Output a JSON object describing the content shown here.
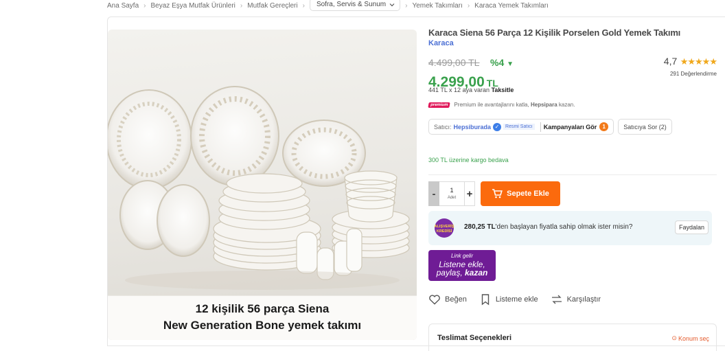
{
  "breadcrumb": {
    "items": [
      "Ana Sayfa",
      "Beyaz Eşya Mutfak Ürünleri",
      "Mutfak Gereçleri",
      "Sofra, Servis & Sunum",
      "Yemek Takımları",
      "Karaca Yemek Takımları"
    ]
  },
  "product": {
    "title": "Karaca Siena 56 Parça 12 Kişilik Porselen Gold Yemek Takımı",
    "brand": "Karaca",
    "old_price": "4.499,00 TL",
    "discount": "%4",
    "price": "4.299,00",
    "currency": "TL",
    "rating": "4,7",
    "stars": "★★★★★",
    "rating_count": "291 Değerlendirme",
    "image_caption_line1": "12 kişilik 56 parça Siena",
    "image_caption_line2": "New Generation Bone yemek takımı"
  },
  "installment": {
    "text": "441 TL x 12 aya varan",
    "bold": "Taksitle"
  },
  "premium": {
    "badge": "premium",
    "text_a": "Premium ile avantajlarını katla,",
    "bold": "Hepsipara",
    "text_b": "kazan."
  },
  "seller": {
    "label": "Satıcı:",
    "name": "Hepsiburada",
    "official": "Resmi Satıcı",
    "campaigns": "Kampanyaları Gör",
    "campaign_count": "1",
    "ask": "Satıcıya Sor (2)"
  },
  "shipping": {
    "text": "300 TL üzerine kargo bedava"
  },
  "quantity": {
    "value": "1",
    "unit": "Adet",
    "minus": "-",
    "plus": "+"
  },
  "cart": {
    "label": "Sepete Ekle"
  },
  "credit": {
    "amount": "280,25 TL",
    "text": "'den başlayan fiyatla sahip olmak ister misin?",
    "button": "Faydalan",
    "logo_line1": "ALIŞVERİŞ",
    "logo_line2": "KREDİSİ"
  },
  "link_promo": {
    "line0": "Link gelir",
    "line1": "Listene ekle,",
    "line2": "paylaş,",
    "line3": "kazan"
  },
  "actions": {
    "like": "Beğen",
    "list": "Listeme ekle",
    "compare": "Karşılaştır"
  },
  "delivery": {
    "title": "Teslimat Seçenekleri",
    "location": "Konum seç"
  },
  "colors": {
    "accent": "#fb6a0d",
    "green": "#3aa14d",
    "blue": "#4b6fd4"
  }
}
